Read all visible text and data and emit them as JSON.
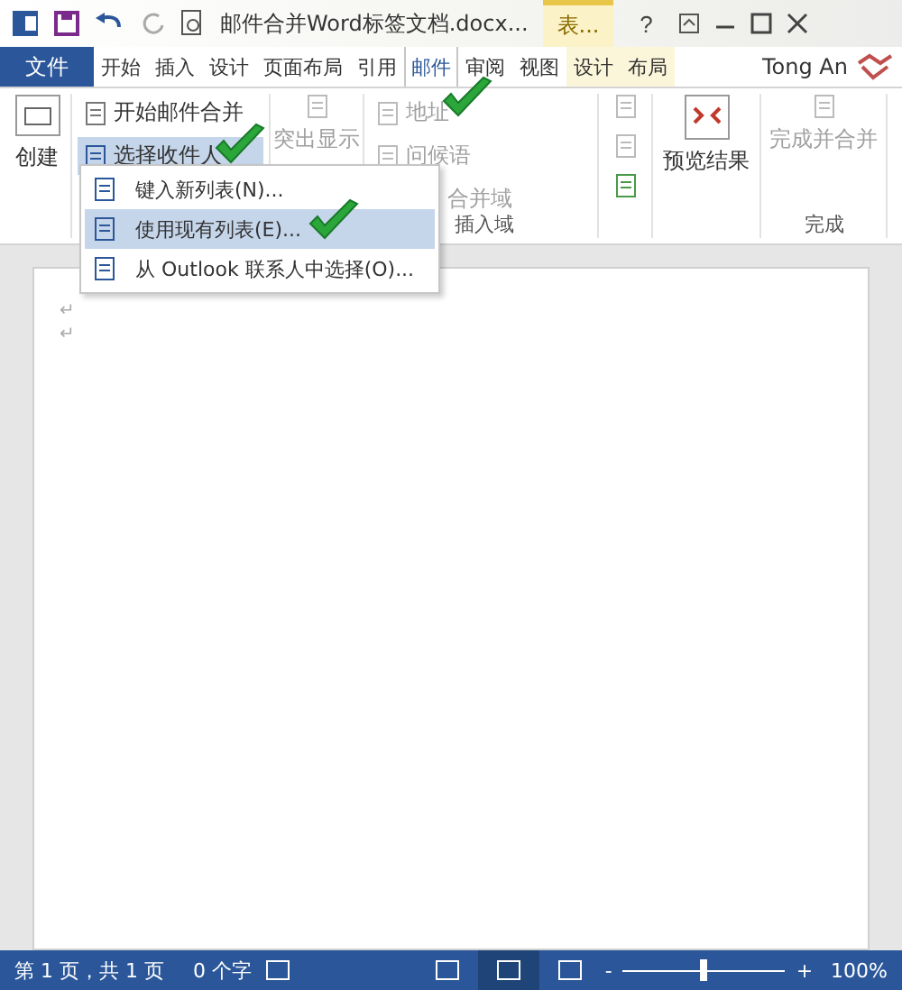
{
  "title_bar": {
    "title": "邮件合并Word标签文档.docx...",
    "context_tab": "表...",
    "help": "?"
  },
  "file_tab": "文件",
  "tabs": [
    {
      "label": "开始",
      "kind": "normal",
      "selected": false
    },
    {
      "label": "插入",
      "kind": "normal",
      "selected": false
    },
    {
      "label": "设计",
      "kind": "normal",
      "selected": false
    },
    {
      "label": "页面布局",
      "kind": "normal",
      "selected": false
    },
    {
      "label": "引用",
      "kind": "normal",
      "selected": false
    },
    {
      "label": "邮件",
      "kind": "normal",
      "selected": true
    },
    {
      "label": "审阅",
      "kind": "normal",
      "selected": false
    },
    {
      "label": "视图",
      "kind": "normal",
      "selected": false
    },
    {
      "label": "设计",
      "kind": "context",
      "selected": false
    },
    {
      "label": "布局",
      "kind": "context",
      "selected": false
    }
  ],
  "user": "Tong An",
  "ribbon": {
    "create": "创建",
    "start_merge": "开始邮件合并",
    "select_recipients": "选择收件人",
    "highlight": "突出显示",
    "address_block": "地址",
    "greeting": "问候语",
    "insert_field": "合并域",
    "insert_group": "插入域",
    "preview": "预览结果",
    "finish": "完成并合并",
    "finish_group": "完成"
  },
  "menu": [
    {
      "label": "键入新列表(N)...",
      "selected": false
    },
    {
      "label": "使用现有列表(E)...",
      "selected": true
    },
    {
      "label": "从 Outlook 联系人中选择(O)...",
      "selected": false
    }
  ],
  "paragraph_marks": [
    "↵",
    "↵"
  ],
  "status_bar": {
    "page": "第 1 页，共 1 页",
    "words": "0 个字",
    "views": [
      {
        "selected": false
      },
      {
        "selected": true
      },
      {
        "selected": false
      }
    ],
    "zoom_minus": "-",
    "zoom_plus": "+",
    "zoom": {
      "level": 0.5
    },
    "zoom_text": "100%"
  }
}
